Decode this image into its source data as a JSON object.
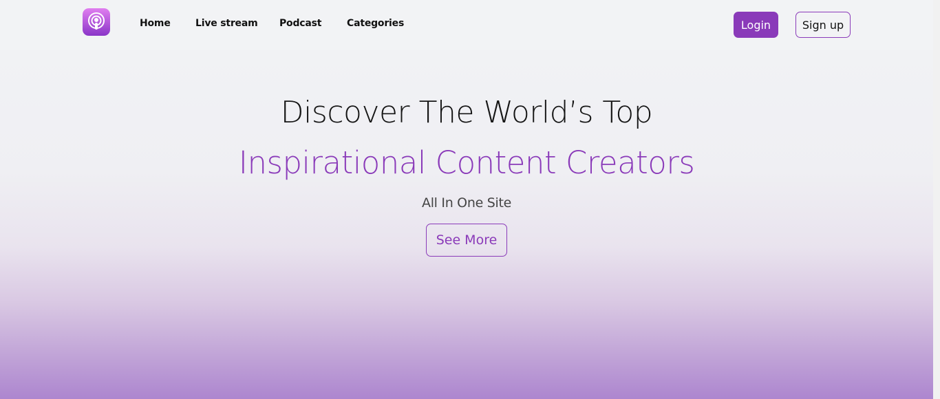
{
  "colors": {
    "accent": "#8a3ab9",
    "text": "#111111"
  },
  "header": {
    "logo_icon": "podcast-icon",
    "nav": [
      "Home",
      "Live stream",
      "Podcast",
      "Categories"
    ],
    "login_label": "Login",
    "signup_label": "Sign up"
  },
  "hero": {
    "line1": "Discover The World’s Top",
    "line2": "Inspirational Content Creators",
    "subtitle": "All In One Site",
    "cta_label": "See More"
  }
}
